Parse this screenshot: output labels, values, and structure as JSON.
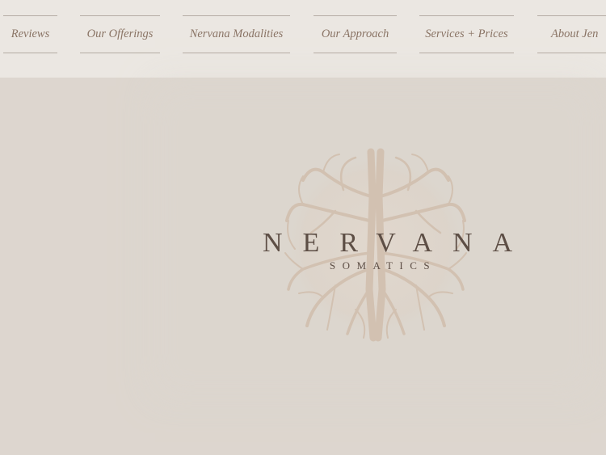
{
  "nav": {
    "items": [
      {
        "label": "Reviews"
      },
      {
        "label": "Our Offerings"
      },
      {
        "label": "Nervana Modalities"
      },
      {
        "label": "Our Approach"
      },
      {
        "label": "Services + Prices"
      },
      {
        "label": "About Jen"
      }
    ]
  },
  "brand": {
    "name": "NERVANA",
    "subtitle": "SOMATICS",
    "logo_icon": "tree-roots-icon"
  },
  "colors": {
    "header_bg": "#ebe7e2",
    "page_bg": "#ddd6cf",
    "nav_text": "#8a7465",
    "brand_text": "#5d4e45",
    "logo_tree": "#d2c1b1"
  }
}
